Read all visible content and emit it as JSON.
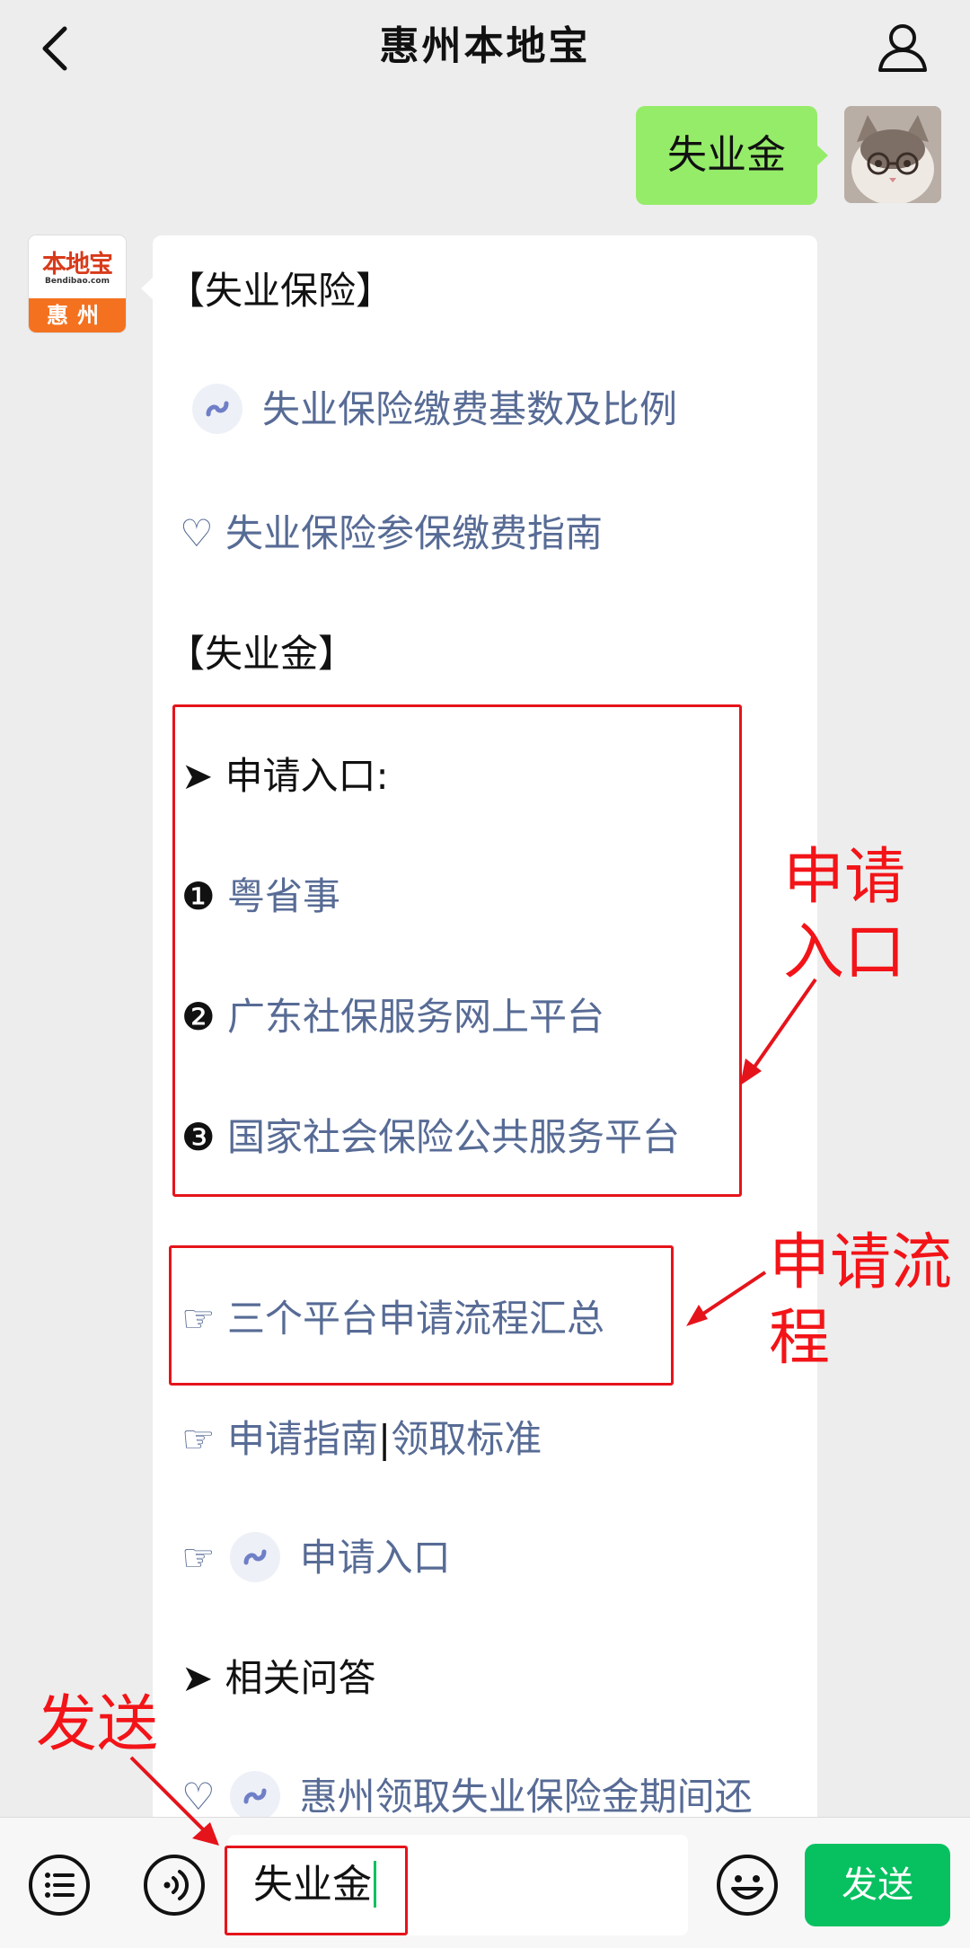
{
  "header": {
    "title": "惠州本地宝"
  },
  "outgoing": {
    "text": "失业金"
  },
  "bot_avatar": {
    "logo_text": "本地宝",
    "logo_url": "Bendibao.com",
    "city": "惠州"
  },
  "reply": {
    "section1": "【失业保险】",
    "link1": "失业保险缴费基数及比例",
    "link2": "♡ 失业保险参保缴费指南",
    "section2": "【失业金】",
    "entry_heading": "➤ 申请入口:",
    "entry_items": [
      {
        "marker": "❶",
        "label": "粤省事"
      },
      {
        "marker": "❷",
        "label": "广东社保服务网上平台"
      },
      {
        "marker": "❸",
        "label": "国家社会保险公共服务平台"
      }
    ],
    "process_link": "☞ 三个平台申请流程汇总",
    "guide_prefix": "☞",
    "guide_link1": "申请指南",
    "guide_sep": "|",
    "guide_link2": "领取标准",
    "entry_link_prefix": "☞",
    "entry_link": "申请入口",
    "qa_heading": "➤ 相关问答",
    "qa_prefix": "♡",
    "qa_link": "惠州领取失业保险金期间还"
  },
  "annotations": {
    "entry": "申请入口",
    "process": "申请流程",
    "send": "发送"
  },
  "input": {
    "value": "失业金"
  },
  "send_button": {
    "label": "发送"
  },
  "colors": {
    "link": "#576b95",
    "annotation": "#e5141b",
    "send": "#07c160",
    "bubble_out": "#95ec69"
  }
}
